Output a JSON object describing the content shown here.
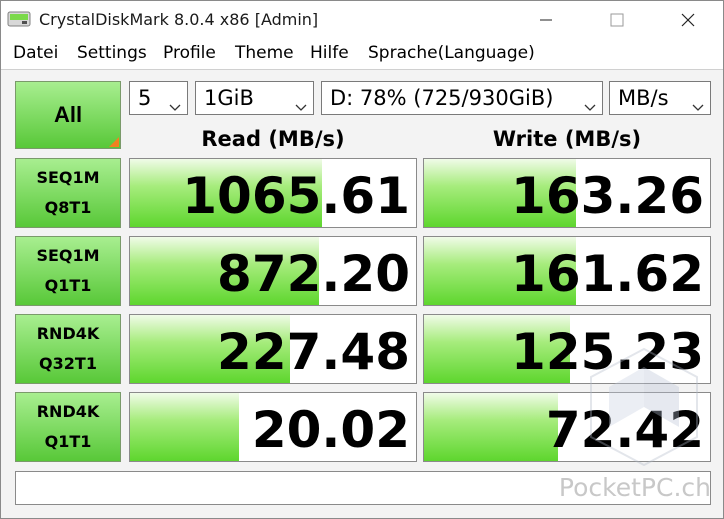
{
  "window": {
    "title": "CrystalDiskMark 8.0.4 x86 [Admin]"
  },
  "menu": [
    "Datei",
    "Settings",
    "Profile",
    "Theme",
    "Hilfe",
    "Sprache(Language)"
  ],
  "controls": {
    "all_label": "All",
    "count": "5",
    "size": "1GiB",
    "drive": "D: 78% (725/930GiB)",
    "unit": "MB/s"
  },
  "headers": {
    "read": "Read (MB/s)",
    "write": "Write (MB/s)"
  },
  "rows": [
    {
      "line1": "SEQ1M",
      "line2": "Q8T1",
      "read": "1065.61",
      "write": "163.26",
      "read_fill": 0.67,
      "write_fill": 0.53
    },
    {
      "line1": "SEQ1M",
      "line2": "Q1T1",
      "read": "872.20",
      "write": "161.62",
      "read_fill": 0.66,
      "write_fill": 0.53
    },
    {
      "line1": "RND4K",
      "line2": "Q32T1",
      "read": "227.48",
      "write": "125.23",
      "read_fill": 0.56,
      "write_fill": 0.51
    },
    {
      "line1": "RND4K",
      "line2": "Q1T1",
      "read": "20.02",
      "write": "72.42",
      "read_fill": 0.38,
      "write_fill": 0.47
    }
  ],
  "comment": "",
  "watermark": "PocketPC.ch",
  "colors": {
    "accent_green": "#5ed62e",
    "corner_orange": "#f08020"
  }
}
